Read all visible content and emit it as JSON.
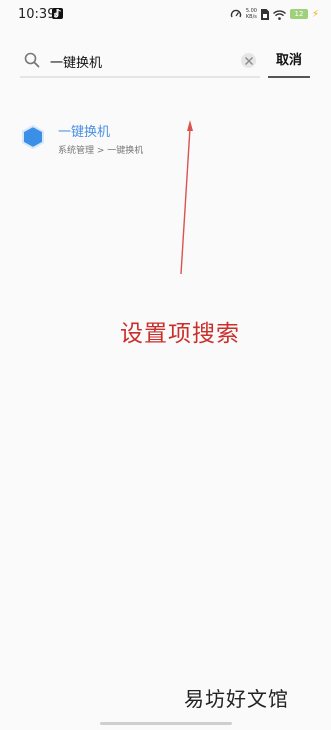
{
  "status_bar": {
    "time": "10:39",
    "speed_value": "5.00",
    "speed_unit": "KB/s",
    "battery": "12"
  },
  "search": {
    "query": "一键换机",
    "cancel_label": "取消"
  },
  "results": [
    {
      "title": "一键换机",
      "path": "系统管理 > 一键换机",
      "icon": "hexagon-icon"
    }
  ],
  "annotation": {
    "text": "设置项搜索",
    "color": "#c9302c"
  },
  "watermark": "易坊好文馆",
  "colors": {
    "accent": "#4a90e2",
    "annotation": "#c9302c"
  }
}
